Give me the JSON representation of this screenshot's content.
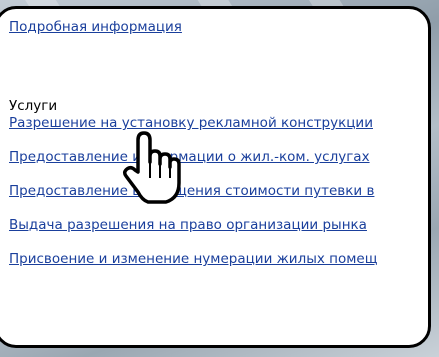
{
  "details_link": "Подробная информация",
  "services": {
    "heading": "Услуги",
    "items": [
      "Разрешение на установку рекламной конструкции",
      "Предоставление информации о жил.-ком. услугах",
      "Предоставление возмещения стоимости путевки в",
      "Выдача разрешения на право организации рынка",
      "Присвоение и изменение нумерации жилых помещ"
    ]
  },
  "colors": {
    "link": "#1a3f9c",
    "panel_border": "#000000",
    "panel_background": "#ffffff"
  },
  "cursor_icon": "hand-pointer-icon"
}
